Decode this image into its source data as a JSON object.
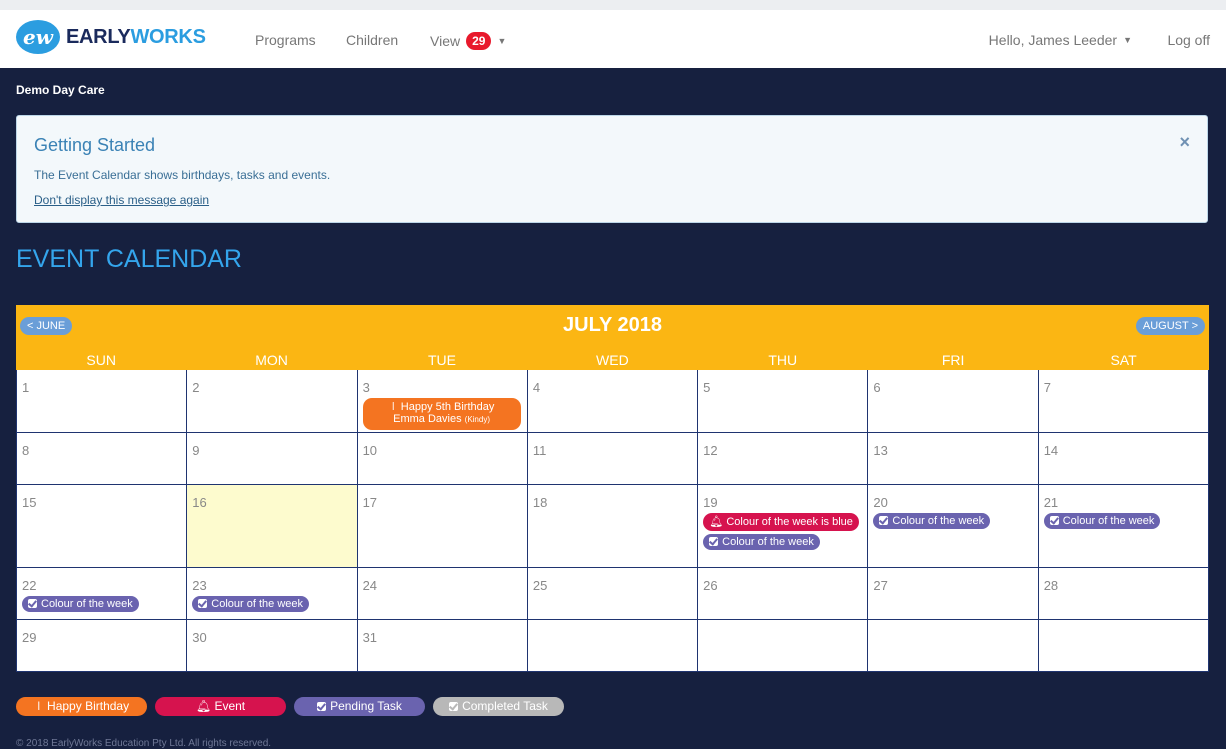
{
  "brand": {
    "badge": "ew",
    "name_early": "EARLY",
    "name_works": "WORKS"
  },
  "nav": {
    "programs": "Programs",
    "children": "Children",
    "view": "View",
    "view_count": "29",
    "user": "Hello, James Leeder",
    "logoff": "Log off"
  },
  "org_name": "Demo Day Care",
  "alert": {
    "title": "Getting Started",
    "text": "The Event Calendar shows birthdays, tasks and events.",
    "link": "Don't display this message again",
    "close": "×"
  },
  "page_title": "EVENT CALENDAR",
  "calendar": {
    "month": "JULY 2018",
    "prev": "< JUNE",
    "next": "AUGUST >",
    "weekdays": [
      "SUN",
      "MON",
      "TUE",
      "WED",
      "THU",
      "FRI",
      "SAT"
    ],
    "days": [
      "1",
      "2",
      "3",
      "4",
      "5",
      "6",
      "7",
      "8",
      "9",
      "10",
      "11",
      "12",
      "13",
      "14",
      "15",
      "16",
      "17",
      "18",
      "19",
      "20",
      "21",
      "22",
      "23",
      "24",
      "25",
      "26",
      "27",
      "28",
      "29",
      "30",
      "31"
    ],
    "birthday_line1": "Happy 5th Birthday",
    "birthday_line2": "Emma Davies",
    "birthday_class": "(Kindy)",
    "event_label": "Colour of the week is blue",
    "task_label": "Colour of the week"
  },
  "legend": {
    "birthday": "Happy Birthday",
    "event": "Event",
    "pending": "Pending Task",
    "completed": "Completed Task"
  },
  "footer": "© 2018 EarlyWorks Education Pty Ltd. All rights reserved.",
  "colors": {
    "background": "#16203f",
    "header_orange": "#fbb613",
    "title_blue": "#34a5ec",
    "birthday": "#f47421",
    "event": "#d6134e",
    "pending": "#6a63af",
    "completed": "#b8b8b8",
    "today": "#fdfbce"
  }
}
